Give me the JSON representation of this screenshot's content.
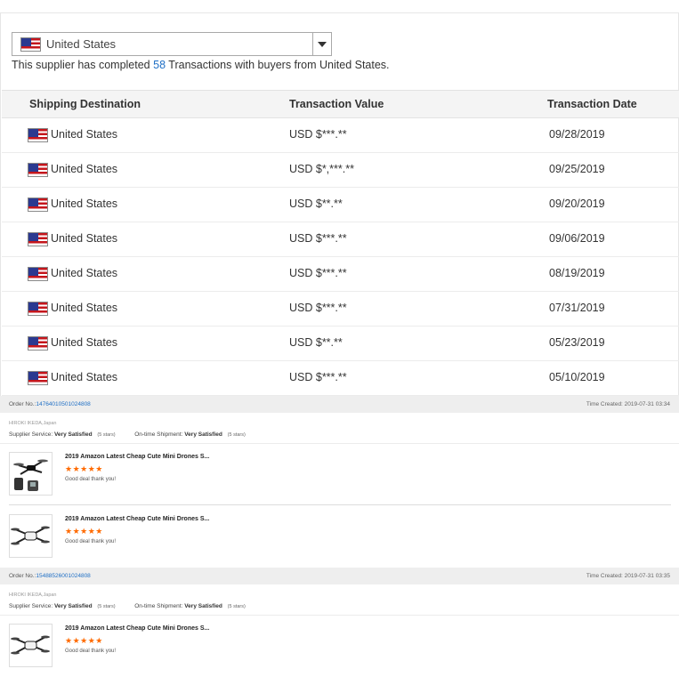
{
  "country_select": {
    "selected": "United States"
  },
  "summary": {
    "prefix": "This supplier has completed",
    "count": "58",
    "suffix": "Transactions with buyers from United States."
  },
  "table": {
    "headers": {
      "destination": "Shipping Destination",
      "value": "Transaction Value",
      "date": "Transaction Date"
    },
    "rows": [
      {
        "destination": "United States",
        "value": "USD $***.**",
        "date": "09/28/2019"
      },
      {
        "destination": "United States",
        "value": "USD $*,***.**",
        "date": "09/25/2019"
      },
      {
        "destination": "United States",
        "value": "USD $**.**",
        "date": "09/20/2019"
      },
      {
        "destination": "United States",
        "value": "USD $***.**",
        "date": "09/06/2019"
      },
      {
        "destination": "United States",
        "value": "USD $***.**",
        "date": "08/19/2019"
      },
      {
        "destination": "United States",
        "value": "USD $***.**",
        "date": "07/31/2019"
      },
      {
        "destination": "United States",
        "value": "USD $**.**",
        "date": "05/23/2019"
      },
      {
        "destination": "United States",
        "value": "USD $***.**",
        "date": "05/10/2019"
      }
    ]
  },
  "orders": [
    {
      "order_label": "Order No.:",
      "order_no": "147640105010248­08",
      "time_created": "Time Created: 2019-07-31 03:34",
      "buyer": "HIROKI IKEDA,Japan",
      "supplier_label": "Supplier Service:",
      "supplier_value": "Very Satisfied",
      "supplier_paren": "(5 stars)",
      "shipment_label": "On-time Shipment:",
      "shipment_value": "Very Satisfied",
      "shipment_paren": "(5 stars)",
      "items": [
        {
          "title": "2019 Amazon Latest Cheap Cute Mini Drones S...",
          "stars": "★★★★★",
          "feedback": "Good deal thank you!"
        },
        {
          "title": "2019 Amazon Latest Cheap Cute Mini Drones S...",
          "stars": "★★★★★",
          "feedback": "Good deal thank you!"
        }
      ]
    },
    {
      "order_label": "Order No.:",
      "order_no": "15488526001024808",
      "time_created": "Time Created: 2019-07-31 03:35",
      "buyer": "HIROKI IKEDA,Japan",
      "supplier_label": "Supplier Service:",
      "supplier_value": "Very Satisfied",
      "supplier_paren": "(5 stars)",
      "shipment_label": "On-time Shipment:",
      "shipment_value": "Very Satisfied",
      "shipment_paren": "(5 stars)",
      "items": [
        {
          "title": "2019 Amazon Latest Cheap Cute Mini Drones S...",
          "stars": "★★★★★",
          "feedback": "Good deal thank you!"
        }
      ]
    }
  ],
  "colors": {
    "link": "#1f6fc5",
    "star": "#ff6a00",
    "flag_red": "#c4161c",
    "flag_blue": "#2b3990"
  },
  "icons": {
    "flag": "us-flag-icon",
    "dropdown": "dropdown-arrow-icon",
    "product": "drone-thumbnail"
  }
}
